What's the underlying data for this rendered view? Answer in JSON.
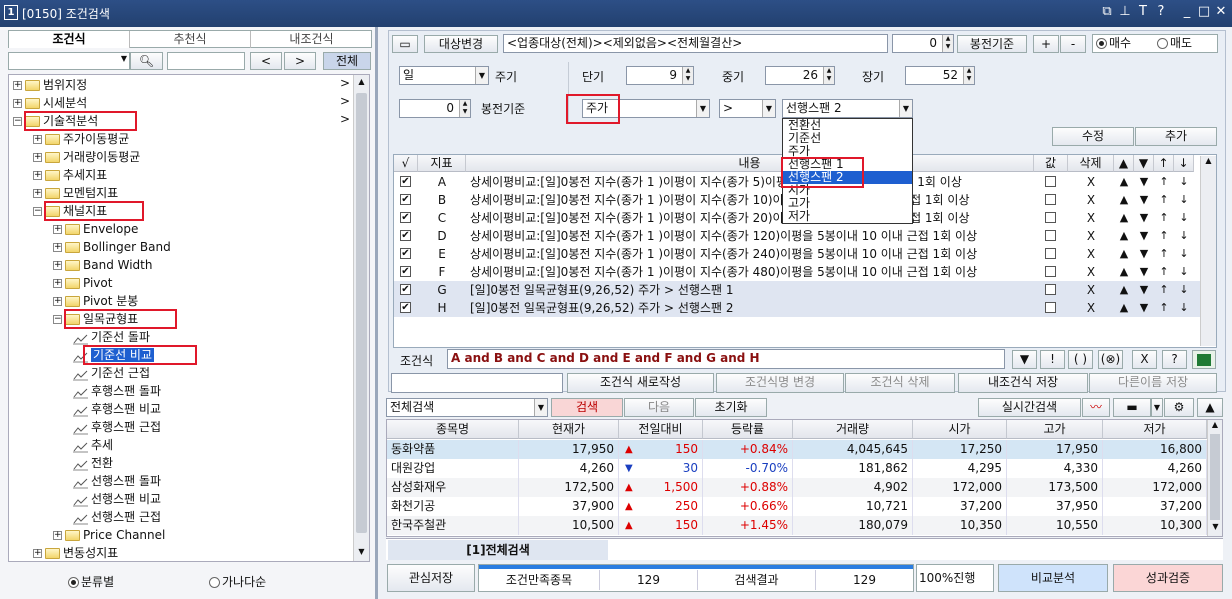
{
  "window": {
    "number": "1",
    "title": "[0150] 조건검색"
  },
  "left": {
    "tabs": [
      "조건식",
      "추천식",
      "내조건식"
    ],
    "search": {
      "all_label": "전체"
    },
    "tree": [
      {
        "label": "범위지정",
        "indent": 0,
        "type": "folder",
        "pm": "+",
        "arrow": ">"
      },
      {
        "label": "시세분석",
        "indent": 0,
        "type": "folder",
        "pm": "+",
        "arrow": ">"
      },
      {
        "label": "기술적분석",
        "indent": 0,
        "type": "folder",
        "pm": "−",
        "arrow": ">",
        "boxed": true
      },
      {
        "label": "주가이동평균",
        "indent": 1,
        "type": "folder",
        "pm": "+"
      },
      {
        "label": "거래량이동평균",
        "indent": 1,
        "type": "folder",
        "pm": "+"
      },
      {
        "label": "추세지표",
        "indent": 1,
        "type": "folder",
        "pm": "+"
      },
      {
        "label": "모멘텀지표",
        "indent": 1,
        "type": "folder",
        "pm": "+"
      },
      {
        "label": "채널지표",
        "indent": 1,
        "type": "folder",
        "pm": "−",
        "boxed": true
      },
      {
        "label": "Envelope",
        "indent": 2,
        "type": "folder",
        "pm": "+"
      },
      {
        "label": "Bollinger Band",
        "indent": 2,
        "type": "folder",
        "pm": "+"
      },
      {
        "label": "Band Width",
        "indent": 2,
        "type": "folder",
        "pm": "+"
      },
      {
        "label": "Pivot",
        "indent": 2,
        "type": "folder",
        "pm": "+"
      },
      {
        "label": "Pivot 분봉",
        "indent": 2,
        "type": "folder",
        "pm": "+"
      },
      {
        "label": "일목균형표",
        "indent": 2,
        "type": "folder",
        "pm": "−",
        "boxed": true
      },
      {
        "label": "기준선 돌파",
        "indent": 3,
        "type": "item"
      },
      {
        "label": "기준선 비교",
        "indent": 3,
        "type": "item",
        "selected": true,
        "boxed": true
      },
      {
        "label": "기준선 근접",
        "indent": 3,
        "type": "item"
      },
      {
        "label": "후행스팬 돌파",
        "indent": 3,
        "type": "item"
      },
      {
        "label": "후행스팬 비교",
        "indent": 3,
        "type": "item"
      },
      {
        "label": "후행스팬 근접",
        "indent": 3,
        "type": "item"
      },
      {
        "label": "추세",
        "indent": 3,
        "type": "item"
      },
      {
        "label": "전환",
        "indent": 3,
        "type": "item"
      },
      {
        "label": "선행스팬 돌파",
        "indent": 3,
        "type": "item"
      },
      {
        "label": "선행스팬 비교",
        "indent": 3,
        "type": "item"
      },
      {
        "label": "선행스팬 근접",
        "indent": 3,
        "type": "item"
      },
      {
        "label": "Price Channel",
        "indent": 2,
        "type": "folder",
        "pm": "+"
      },
      {
        "label": "변동성지표",
        "indent": 1,
        "type": "folder",
        "pm": "+"
      }
    ],
    "radio": [
      {
        "label": "분류별",
        "on": true
      },
      {
        "label": "가나다순",
        "on": false
      }
    ]
  },
  "top": {
    "target_btn": "대상변경",
    "target_text": "<업종대상(전체)><제외없음><전체월결산>",
    "bong_value": "0",
    "bong_btn": "봉전기준",
    "plus": "+",
    "minus": "-",
    "buy": "매수",
    "sell": "매도"
  },
  "form": {
    "period_value": "일",
    "period_label": "주기",
    "short_label": "단기",
    "short_value": "9",
    "mid_label": "중기",
    "mid_value": "26",
    "long_label": "장기",
    "long_value": "52",
    "bong_value": "0",
    "bong_label": "봉전기준",
    "field1": "주가",
    "op": ">",
    "field2": "선행스팬 2",
    "edit_btn": "수정",
    "add_btn": "추가"
  },
  "dropdown": [
    "전환선",
    "기준선",
    "주가",
    "선행스팬 1",
    "선행스팬 2",
    "시가",
    "고가",
    "저가"
  ],
  "grid": {
    "headers": [
      "√",
      "지표",
      "내용",
      "값",
      "삭제",
      "▲",
      "▼",
      "↑",
      "↓"
    ],
    "rows": [
      {
        "id": "A",
        "content": "상세이평비교:[일]0봉전 지수(종가 1 )이평이 지수(종가 5)이평을 5봉이내 10 이내 근접 1회 이상"
      },
      {
        "id": "B",
        "content": "상세이평비교:[일]0봉전 지수(종가 1 )이평이 지수(종가 10)이평을 5봉이내 10 이내 근접 1회 이상"
      },
      {
        "id": "C",
        "content": "상세이평비교:[일]0봉전 지수(종가 1 )이평이 지수(종가 20)이평을 5봉이내 10 이내 근접 1회 이상"
      },
      {
        "id": "D",
        "content": "상세이평비교:[일]0봉전 지수(종가 1 )이평이 지수(종가 120)이평을 5봉이내 10 이내 근접 1회 이상"
      },
      {
        "id": "E",
        "content": "상세이평비교:[일]0봉전 지수(종가 1 )이평이 지수(종가 240)이평을 5봉이내 10 이내 근접 1회 이상"
      },
      {
        "id": "F",
        "content": "상세이평비교:[일]0봉전 지수(종가 1 )이평이 지수(종가 480)이평을 5봉이내 10 이내 근접 1회 이상"
      },
      {
        "id": "G",
        "content": "[일]0봉전 일목균형표(9,26,52) 주가 > 선행스팬 1"
      },
      {
        "id": "H",
        "content": "[일]0봉전 일목균형표(9,26,52) 주가 > 선행스팬 2"
      }
    ],
    "del": "X",
    "up": "▲",
    "down": "▼",
    "top": "↑",
    "bottom": "↓"
  },
  "formula": {
    "label": "조건식",
    "text": "A and B and C and D and E and F and G and H",
    "btns": [
      "▼",
      "!",
      "( )",
      "(⊗)",
      "X",
      "?"
    ]
  },
  "actions": [
    "조건식 새로작성",
    "조건식명 변경",
    "조건식 삭제",
    "내조건식 저장",
    "다른이름 저장"
  ],
  "search_bar": {
    "scope": "전체검색",
    "search": "검색",
    "next": "다음",
    "reset": "초기화",
    "realtime": "실시간검색"
  },
  "results": {
    "headers": [
      "종목명",
      "현재가",
      "전일대비",
      "등락률",
      "거래량",
      "시가",
      "고가",
      "저가"
    ],
    "rows": [
      {
        "name": "동화약품",
        "price": "17,950",
        "dir": "up",
        "chg": "150",
        "rate": "+0.84%",
        "vol": "4,045,645",
        "open": "17,250",
        "high": "17,950",
        "low": "16,800"
      },
      {
        "name": "대원강업",
        "price": "4,260",
        "dir": "dn",
        "chg": "30",
        "rate": "-0.70%",
        "vol": "181,862",
        "open": "4,295",
        "high": "4,330",
        "low": "4,260"
      },
      {
        "name": "삼성화재우",
        "price": "172,500",
        "dir": "up",
        "chg": "1,500",
        "rate": "+0.88%",
        "vol": "4,902",
        "open": "172,000",
        "high": "173,500",
        "low": "172,000"
      },
      {
        "name": "화천기공",
        "price": "37,900",
        "dir": "up",
        "chg": "250",
        "rate": "+0.66%",
        "vol": "10,721",
        "open": "37,200",
        "high": "37,950",
        "low": "37,200"
      },
      {
        "name": "한국주철관",
        "price": "10,500",
        "dir": "up",
        "chg": "150",
        "rate": "+1.45%",
        "vol": "180,079",
        "open": "10,350",
        "high": "10,550",
        "low": "10,300"
      }
    ],
    "tab": "[1]전체검색"
  },
  "footer": {
    "save": "관심저장",
    "cond_label": "조건만족종목",
    "cond_count": "129",
    "result_label": "검색결과",
    "result_count": "129",
    "progress": "100%진행",
    "progress_pct": 100,
    "compare": "비교분석",
    "verify": "성과검증"
  }
}
